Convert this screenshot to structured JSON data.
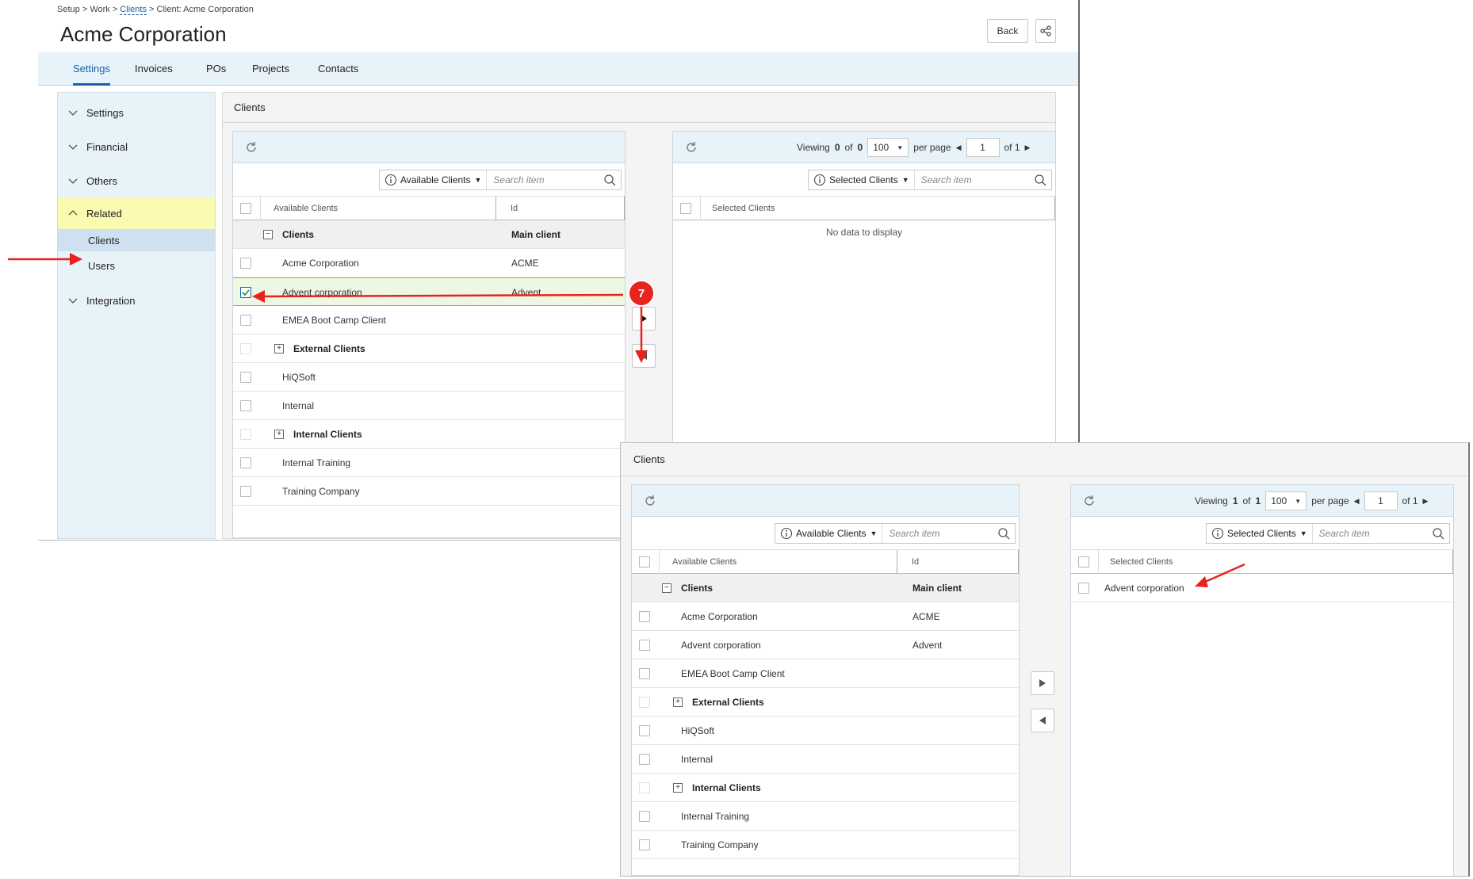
{
  "breadcrumb": {
    "setup": "Setup",
    "sep": ">",
    "work": "Work",
    "clients": "Clients",
    "current": "Client: Acme Corporation"
  },
  "page_title": "Acme Corporation",
  "header_buttons": {
    "back": "Back",
    "share_icon": "share-icon"
  },
  "tabs": [
    {
      "label": "Settings",
      "active": true
    },
    {
      "label": "Invoices"
    },
    {
      "label": "POs"
    },
    {
      "label": "Projects"
    },
    {
      "label": "Contacts"
    }
  ],
  "sidebar": {
    "items": [
      {
        "label": "Settings"
      },
      {
        "label": "Financial"
      },
      {
        "label": "Others"
      },
      {
        "label": "Related",
        "expanded": true,
        "highlight": "#fafab0"
      },
      {
        "label": "Integration"
      }
    ],
    "sub_items": [
      {
        "label": "Clients",
        "selected": true
      },
      {
        "label": "Users"
      }
    ]
  },
  "section_title": "Clients",
  "available": {
    "dropdown": "Available Clients",
    "search_placeholder": "Search item",
    "col_name": "Available Clients",
    "col_id": "Id",
    "group_label": "Clients",
    "group_id": "Main client",
    "rows": [
      {
        "name": "Acme Corporation",
        "id": "ACME"
      },
      {
        "name": "Advent corporation",
        "id": "Advent"
      },
      {
        "name": "EMEA Boot Camp Client",
        "id": ""
      },
      {
        "name": "External Clients",
        "id": "",
        "group": true
      },
      {
        "name": "HiQSoft",
        "id": ""
      },
      {
        "name": "Internal",
        "id": ""
      },
      {
        "name": "Internal Clients",
        "id": "",
        "group": true
      },
      {
        "name": "Internal Training",
        "id": ""
      },
      {
        "name": "Training Company",
        "id": ""
      }
    ]
  },
  "selected_before": {
    "dropdown": "Selected Clients",
    "search_placeholder": "Search item",
    "col_name": "Selected Clients",
    "viewing_label": "Viewing",
    "viewing_a": "0",
    "viewing_of": "of",
    "viewing_b": "0",
    "per_page_value": "100",
    "per_page_label": "per page",
    "page": "1",
    "of_pages": "of 1",
    "empty_text": "No data to display"
  },
  "selected_after": {
    "dropdown": "Selected Clients",
    "search_placeholder": "Search item",
    "col_name": "Selected Clients",
    "viewing_label": "Viewing",
    "viewing_a": "1",
    "viewing_of": "of",
    "viewing_b": "1",
    "per_page_value": "100",
    "per_page_label": "per page",
    "page": "1",
    "of_pages": "of 1",
    "rows": [
      "Advent corporation"
    ]
  },
  "annotation": {
    "step_number": "7",
    "color": "#e8231d"
  },
  "colors": {
    "accent": "#1a5fa8",
    "light_blue": "#e8f2f9",
    "arrow": "#e8231d",
    "checked_row": "#eef7e4"
  }
}
